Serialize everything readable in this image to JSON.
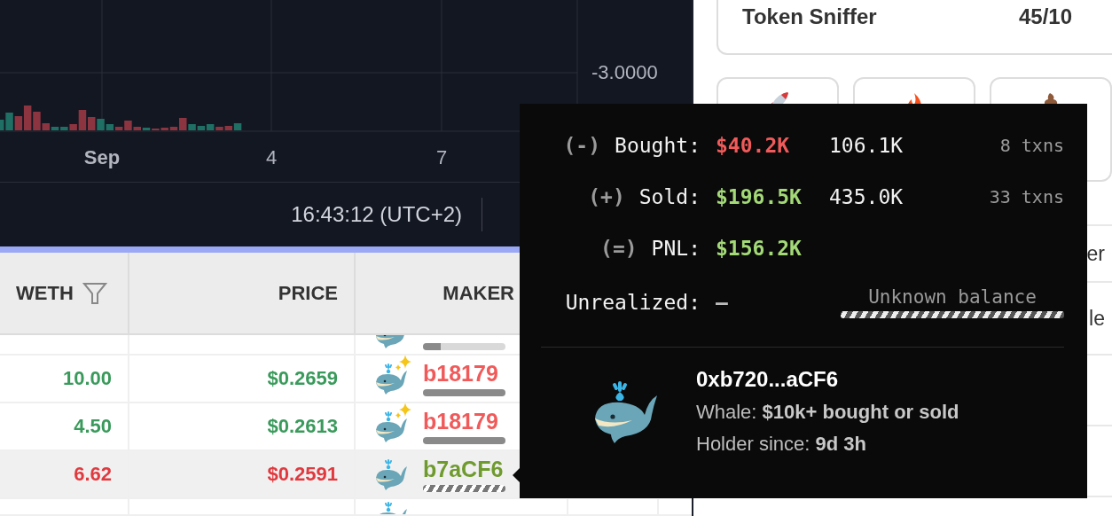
{
  "chart": {
    "price_label": "-3.0000",
    "x_labels": [
      {
        "label": "Sep",
        "kind": "month"
      },
      {
        "label": "4",
        "kind": "day"
      },
      {
        "label": "7",
        "kind": "day"
      }
    ],
    "time": "16:43:12 (UTC+2)"
  },
  "table": {
    "columns": [
      {
        "label": "WETH",
        "filter": true
      },
      {
        "label": "PRICE",
        "filter": false
      },
      {
        "label": "MAKER",
        "filter": false
      }
    ],
    "rows": [
      {
        "kind": "clipped_top",
        "hatched": false,
        "level": 0.22
      },
      {
        "kind": "full",
        "weth": "10.00",
        "price": "$0.2659",
        "negative": false,
        "maker": "b18179",
        "color": "#f05a5a",
        "sparkles": true,
        "hatched": false,
        "level": 1,
        "selected": false
      },
      {
        "kind": "full",
        "weth": "4.50",
        "price": "$0.2613",
        "negative": false,
        "maker": "b18179",
        "color": "#f05a5a",
        "sparkles": true,
        "hatched": false,
        "level": 1,
        "selected": false
      },
      {
        "kind": "full",
        "weth": "6.62",
        "price": "$0.2591",
        "negative": true,
        "maker": "b7aCF6",
        "color": "#6f9a2e",
        "sparkles": false,
        "hatched": true,
        "level": 1,
        "selected": true
      },
      {
        "kind": "clipped_bottom"
      }
    ]
  },
  "side_panel": {
    "token_sniffer": {
      "label": "Token Sniffer",
      "score": "45/10"
    },
    "buttons": [
      {
        "kind": "rocket"
      },
      {
        "kind": "fire"
      },
      {
        "kind": "pile"
      }
    ],
    "list": [
      "er",
      "le"
    ]
  },
  "tooltip": {
    "stats": [
      {
        "sign": "(-)",
        "label": "Bought:",
        "value": "$40.2K",
        "negative": true,
        "amount": "106.1K",
        "txns": "8 txns"
      },
      {
        "sign": "(+)",
        "label": "Sold:",
        "value": "$196.5K",
        "negative": false,
        "amount": "435.0K",
        "txns": "33 txns"
      },
      {
        "sign": "(=)",
        "label": "PNL:",
        "value": "$156.2K",
        "negative": false
      }
    ],
    "unrealized": {
      "label": "Unrealized:",
      "value": "–",
      "balance": "Unknown balance"
    },
    "address": "0xb720...aCF6",
    "lines": [
      "Whale: **$10k+ bought or sold**",
      "Holder since: **9d 3h**"
    ]
  }
}
